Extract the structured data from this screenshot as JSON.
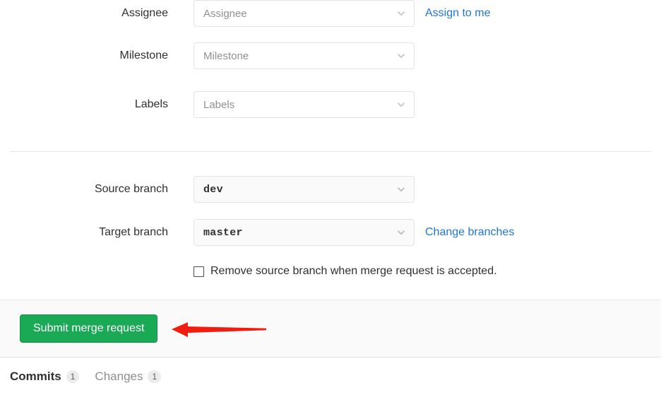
{
  "form": {
    "fields": [
      {
        "label": "Assignee",
        "placeholder": "Assignee",
        "icon": "chevron-down-icon",
        "link": "Assign to me"
      },
      {
        "label": "Milestone",
        "placeholder": "Milestone",
        "icon": "chevron-down-icon",
        "link": ""
      },
      {
        "label": "Labels",
        "placeholder": "Labels",
        "icon": "chevron-down-icon",
        "link": ""
      }
    ],
    "branches": [
      {
        "label": "Source branch",
        "value": "dev",
        "icon": "chevron-down-icon",
        "link": ""
      },
      {
        "label": "Target branch",
        "value": "master",
        "icon": "chevron-down-icon",
        "link": "Change branches"
      }
    ],
    "remove_branch_checkbox": {
      "label": "Remove source branch when merge request is accepted.",
      "checked": false
    }
  },
  "footer": {
    "submit_label": "Submit merge request"
  },
  "annotation": {
    "shape": "left-arrow",
    "color": "#f01e10"
  },
  "tabs": [
    {
      "label": "Commits",
      "badge": "1",
      "active": true
    },
    {
      "label": "Changes",
      "badge": "1",
      "active": false
    }
  ],
  "colors": {
    "accent_green": "#1aaa55",
    "link_blue": "#1f78d1",
    "annotation_red": "#f01e10",
    "panel_gray": "#fafafa",
    "border_gray": "#e5e5e5"
  }
}
